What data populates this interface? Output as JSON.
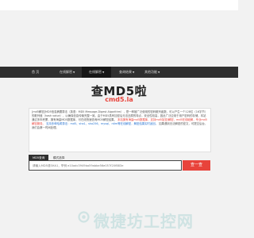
{
  "nav": {
    "items": [
      {
        "label": "首 页",
        "caret": false
      },
      {
        "label": "在线解密",
        "caret": true
      },
      {
        "label": "在线解密",
        "caret": true
      },
      {
        "label": "查询结果",
        "caret": true
      },
      {
        "label": "其他功能",
        "caret": true
      }
    ],
    "caret": "▼"
  },
  "brand": {
    "title": "查MD5啦",
    "subtitle": "cmd5.la"
  },
  "description": {
    "part1": "[md5解密]MD5信息摘要算法（英语：MD5 Message-Digest Algorithm），是一种被广泛使用的密码散列函数，可以产生一个128位（16字节）的散列值（hash value），以确保信息传输完整一致。由于MD5具有加密后无法还原的特点，安全性较高，因此广泛应用于用户密码的存储。本站通过多年积累，拥有海量MD5数据库，可在线快速查询MD5解密结果。",
    "part2_red": "本站拥有海量md5数据库，支持md5加密/解密，md5在线破解，专业md5解密服务。",
    "part3_blue": "支持多种哈希算法：md5、sha1、sha256、mysql、ntlm等在线解密，解密结果实时返回。",
    "part4": "如果遇到无法解密的密文，可提交后台，我们会第一时间处理。"
  },
  "tabs": {
    "active": "MD5查询",
    "inactive": "模式选择"
  },
  "search": {
    "placeholder": "请输入MD5或SHA1，举例 e10adc3949ba59abbe56e057f20f883e",
    "button": "查一查"
  },
  "watermark": {
    "text": "微捷坊工控网"
  }
}
